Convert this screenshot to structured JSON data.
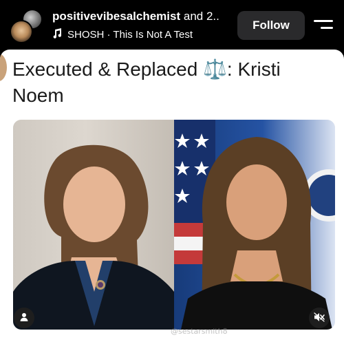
{
  "header": {
    "author": "positivevibesalchemist",
    "coauthor_suffix": "and 2..",
    "music": "SHOSH · This Is Not A Test",
    "follow_label": "Follow",
    "icons": {
      "music": "music-note-icon",
      "menu": "menu-icon"
    }
  },
  "post": {
    "headline": "Executed & Replaced ⚖️: Kristi Noem",
    "watermark": "@sestarsmith8",
    "icons": {
      "user": "person-icon",
      "mute": "muted-speaker-icon"
    }
  },
  "colors": {
    "background": "#000000",
    "card": "#ffffff",
    "follow_button": "#2a2a2c",
    "text_dark": "#1a1a1a"
  }
}
